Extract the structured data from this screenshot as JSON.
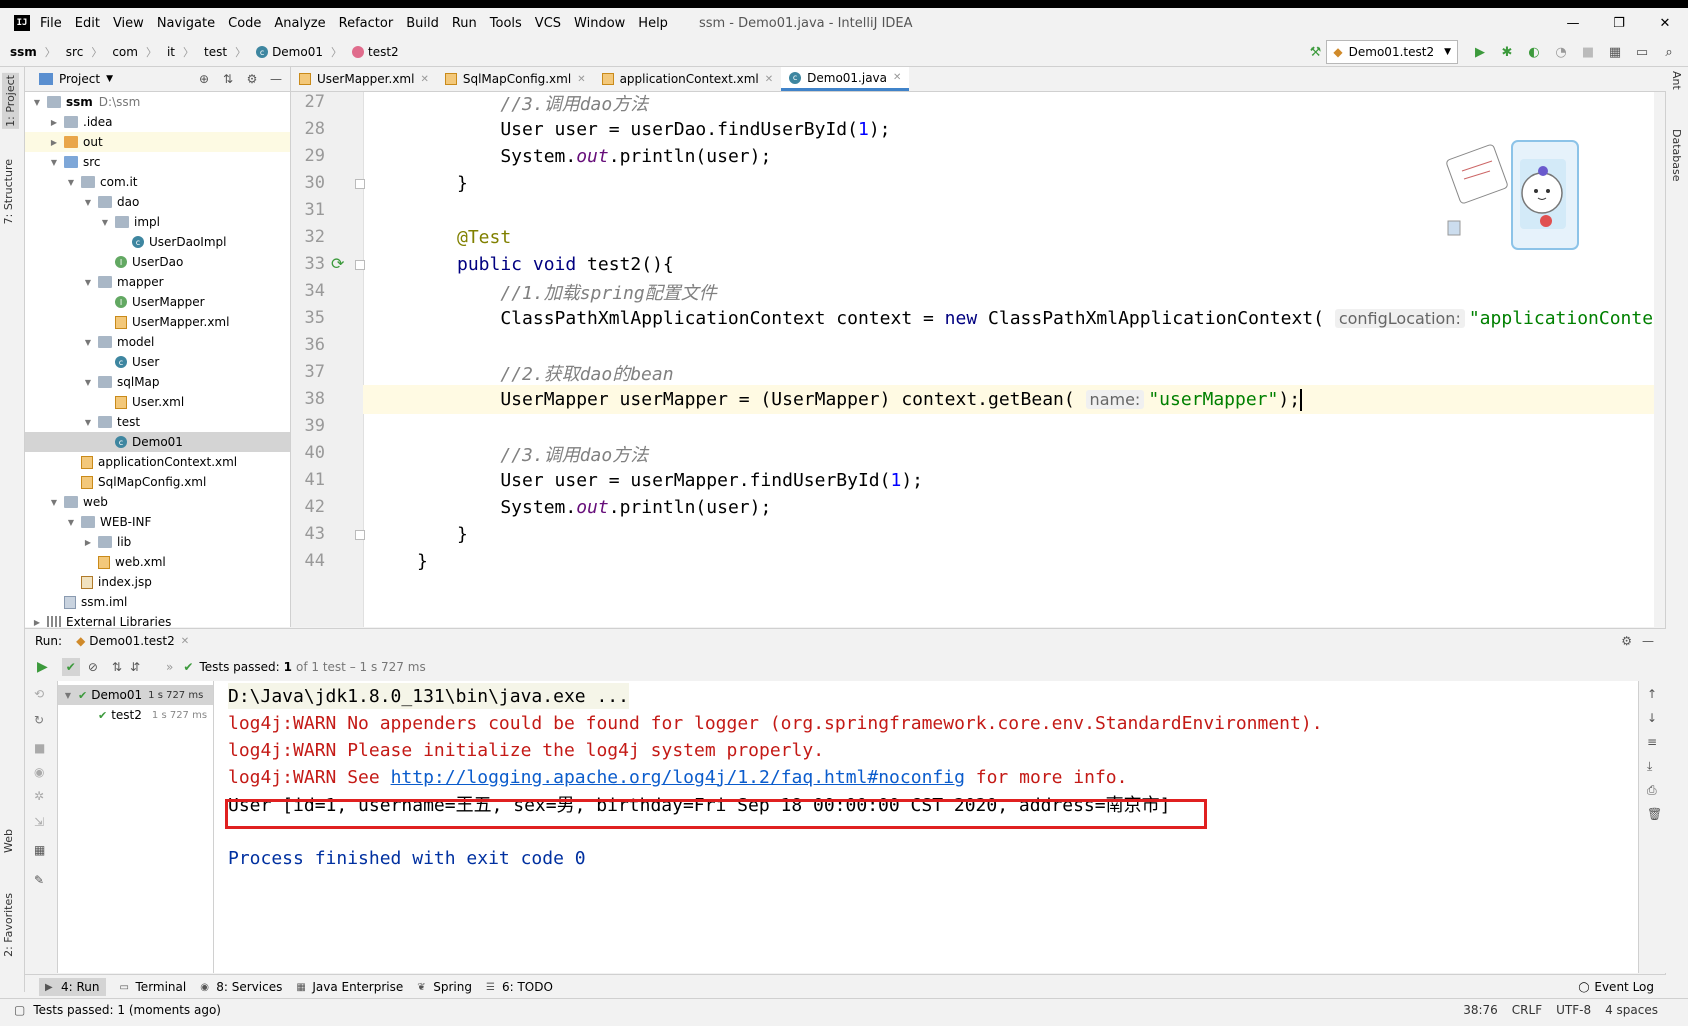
{
  "window": {
    "app_title": "ssm - Demo01.java - IntelliJ IDEA",
    "logo_text": "IJ",
    "menu": [
      "File",
      "Edit",
      "View",
      "Navigate",
      "Code",
      "Analyze",
      "Refactor",
      "Build",
      "Run",
      "Tools",
      "VCS",
      "Window",
      "Help"
    ],
    "controls": {
      "minimize": "—",
      "maximize": "❐",
      "close": "✕"
    }
  },
  "breadcrumbs": [
    "ssm",
    "src",
    "com",
    "it",
    "test",
    "Demo01",
    "test2"
  ],
  "run_config": "Demo01.test2",
  "left_strip": {
    "project_tab": "1: Project",
    "structure_tab": "7: Structure",
    "web_tab": "Web",
    "favorites_tab": "2: Favorites"
  },
  "right_strip": {
    "ant_tab": "Ant",
    "database_tab": "Database"
  },
  "project_panel": {
    "title": "Project",
    "tree": [
      {
        "label": "ssm",
        "suffix": "D:\\ssm",
        "depth": 0,
        "icon": "folder",
        "arrow": "down",
        "bold": true
      },
      {
        "label": ".idea",
        "depth": 1,
        "icon": "folder",
        "arrow": "right"
      },
      {
        "label": "out",
        "depth": 1,
        "icon": "folder-out",
        "arrow": "right",
        "highlight": true
      },
      {
        "label": "src",
        "depth": 1,
        "icon": "folder-src",
        "arrow": "down"
      },
      {
        "label": "com.it",
        "depth": 2,
        "icon": "folder",
        "arrow": "down"
      },
      {
        "label": "dao",
        "depth": 3,
        "icon": "folder",
        "arrow": "down"
      },
      {
        "label": "impl",
        "depth": 4,
        "icon": "folder",
        "arrow": "down"
      },
      {
        "label": "UserDaoImpl",
        "depth": 5,
        "icon": "cls",
        "arrow": ""
      },
      {
        "label": "UserDao",
        "depth": 4,
        "icon": "itf",
        "arrow": ""
      },
      {
        "label": "mapper",
        "depth": 3,
        "icon": "folder",
        "arrow": "down"
      },
      {
        "label": "UserMapper",
        "depth": 4,
        "icon": "itf",
        "arrow": ""
      },
      {
        "label": "UserMapper.xml",
        "depth": 4,
        "icon": "xml",
        "arrow": ""
      },
      {
        "label": "model",
        "depth": 3,
        "icon": "folder",
        "arrow": "down"
      },
      {
        "label": "User",
        "depth": 4,
        "icon": "cls",
        "arrow": ""
      },
      {
        "label": "sqlMap",
        "depth": 3,
        "icon": "folder",
        "arrow": "down"
      },
      {
        "label": "User.xml",
        "depth": 4,
        "icon": "xml",
        "arrow": ""
      },
      {
        "label": "test",
        "depth": 3,
        "icon": "folder",
        "arrow": "down"
      },
      {
        "label": "Demo01",
        "depth": 4,
        "icon": "cls",
        "arrow": "",
        "selected": true
      },
      {
        "label": "applicationContext.xml",
        "depth": 2,
        "icon": "xml",
        "arrow": ""
      },
      {
        "label": "SqlMapConfig.xml",
        "depth": 2,
        "icon": "xml",
        "arrow": ""
      },
      {
        "label": "web",
        "depth": 1,
        "icon": "folder",
        "arrow": "down"
      },
      {
        "label": "WEB-INF",
        "depth": 2,
        "icon": "folder",
        "arrow": "down"
      },
      {
        "label": "lib",
        "depth": 3,
        "icon": "folder",
        "arrow": "right"
      },
      {
        "label": "web.xml",
        "depth": 3,
        "icon": "xml",
        "arrow": ""
      },
      {
        "label": "index.jsp",
        "depth": 2,
        "icon": "jsp",
        "arrow": ""
      },
      {
        "label": "ssm.iml",
        "depth": 1,
        "icon": "iml",
        "arrow": ""
      },
      {
        "label": "External Libraries",
        "depth": 0,
        "icon": "lib",
        "arrow": "right"
      }
    ]
  },
  "editor_tabs": [
    {
      "label": "UserMapper.xml",
      "icon": "xml",
      "active": false
    },
    {
      "label": "SqlMapConfig.xml",
      "icon": "xml",
      "active": false
    },
    {
      "label": "applicationContext.xml",
      "icon": "xml",
      "active": false
    },
    {
      "label": "Demo01.java",
      "icon": "cls",
      "active": true
    }
  ],
  "code": [
    {
      "n": "27",
      "parts": [
        [
          "    ",
          ""
        ],
        [
          "//3.调用dao方法",
          "cm"
        ]
      ]
    },
    {
      "n": "28",
      "parts": [
        [
          "    User user = userDao.findUserById(",
          ""
        ],
        [
          "1",
          "num"
        ],
        [
          ");",
          ""
        ]
      ]
    },
    {
      "n": "29",
      "parts": [
        [
          "    System.",
          ""
        ],
        [
          "out",
          "fld"
        ],
        [
          ".println(user);",
          ""
        ]
      ]
    },
    {
      "n": "30",
      "parts": [
        [
          "}",
          ""
        ]
      ]
    },
    {
      "n": "31",
      "parts": []
    },
    {
      "n": "32",
      "parts": [
        [
          "@Test",
          "an"
        ]
      ]
    },
    {
      "n": "33",
      "parts": [
        [
          "public void ",
          "kw"
        ],
        [
          "test2(){",
          ""
        ]
      ]
    },
    {
      "n": "34",
      "parts": [
        [
          "    ",
          ""
        ],
        [
          "//1.加载spring配置文件",
          "cm"
        ]
      ]
    },
    {
      "n": "35",
      "parts": [
        [
          "    ClassPathXmlApplicationContext context = ",
          ""
        ],
        [
          "new ",
          "kw"
        ],
        [
          "ClassPathXmlApplicationContext( ",
          ""
        ],
        [
          "configLocation:",
          "hint"
        ],
        [
          "\"applicationContext.",
          "st"
        ]
      ]
    },
    {
      "n": "36",
      "parts": []
    },
    {
      "n": "37",
      "parts": [
        [
          "    ",
          ""
        ],
        [
          "//2.获取dao的bean",
          "cm"
        ]
      ]
    },
    {
      "n": "38",
      "parts": [
        [
          "    UserMapper userMapper = (UserMapper) context.getBean( ",
          ""
        ],
        [
          "name:",
          "hint"
        ],
        [
          "\"userMapper\"",
          "st"
        ],
        [
          ");",
          ""
        ]
      ],
      "current": true
    },
    {
      "n": "39",
      "parts": []
    },
    {
      "n": "40",
      "parts": [
        [
          "    ",
          ""
        ],
        [
          "//3.调用dao方法",
          "cm"
        ]
      ]
    },
    {
      "n": "41",
      "parts": [
        [
          "    User user = userMapper.findUserById(",
          ""
        ],
        [
          "1",
          "num"
        ],
        [
          ");",
          ""
        ]
      ]
    },
    {
      "n": "42",
      "parts": [
        [
          "    System.",
          ""
        ],
        [
          "out",
          "fld"
        ],
        [
          ".println(user);",
          ""
        ]
      ]
    },
    {
      "n": "43",
      "parts": [
        [
          "}",
          ""
        ]
      ]
    },
    {
      "n": "44",
      "parts": [
        [
          "}",
          ""
        ]
      ],
      "outdent": true
    }
  ],
  "run_panel": {
    "label": "Run:",
    "tab": "Demo01.test2",
    "status": "Tests passed:",
    "passed_count": "1",
    "status_detail": "of 1 test – 1 s 727 ms",
    "tree": [
      {
        "label": "Demo01",
        "time": "1 s 727 ms"
      },
      {
        "label": "test2",
        "time": "1 s 727 ms"
      }
    ]
  },
  "console": {
    "cmd": "D:\\Java\\jdk1.8.0_131\\bin\\java.exe ...",
    "warn1": "log4j:WARN No appenders could be found for logger (org.springframework.core.env.StandardEnvironment).",
    "warn2": "log4j:WARN Please initialize the log4j system properly.",
    "warn3_pre": "log4j:WARN See ",
    "warn3_link": "http://logging.apache.org/log4j/1.2/faq.html#noconfig",
    "warn3_post": " for more info.",
    "user_line": "User [id=1, username=王五, sex=男, birthday=Fri Sep 18 00:00:00 CST 2020, address=南京市]",
    "exit_line": "Process finished with exit code 0"
  },
  "tool_tabs": [
    "4: Run",
    "Terminal",
    "8: Services",
    "Java Enterprise",
    "Spring",
    "6: TODO"
  ],
  "event_log": "Event Log",
  "status_bar": {
    "message": "Tests passed: 1 (moments ago)",
    "position": "38:76",
    "line_sep": "CRLF",
    "encoding": "UTF-8",
    "indent": "4 spaces"
  },
  "colors": {
    "accent": "#4083c9",
    "pass": "#3c9a3c",
    "highlight_box": "#e02020"
  }
}
